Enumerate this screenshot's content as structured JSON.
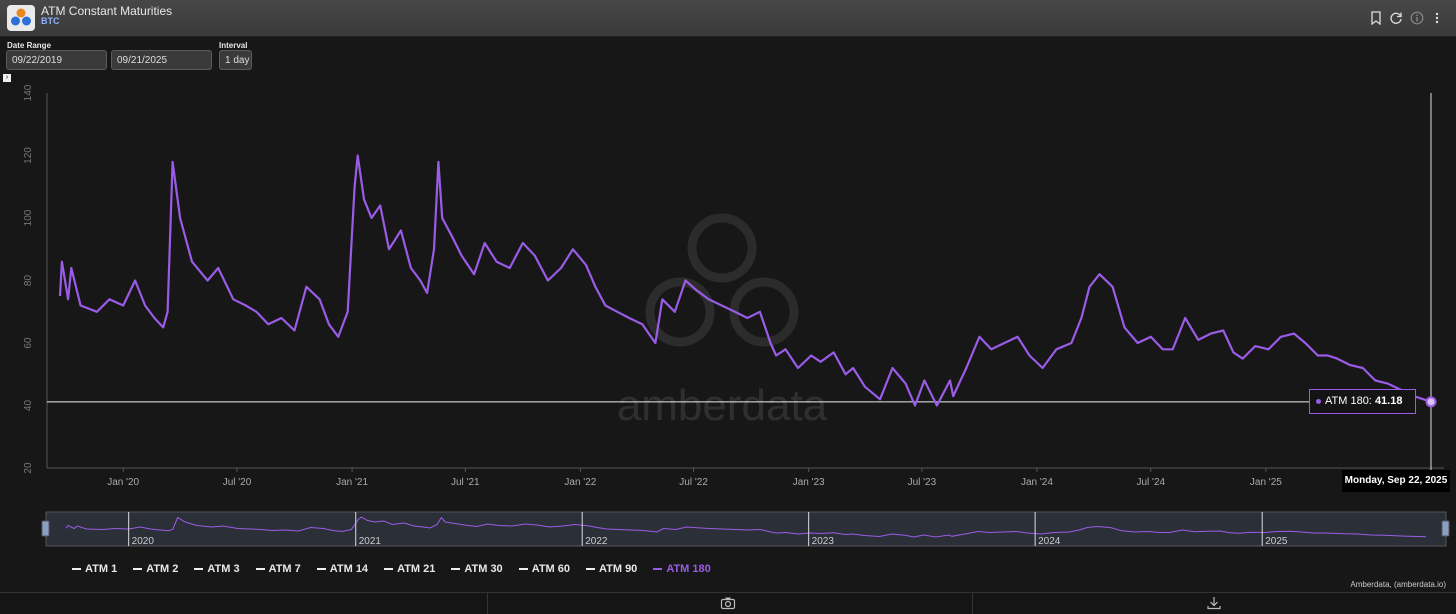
{
  "header": {
    "title": "ATM Constant Maturities",
    "subtitle": "BTC",
    "icons": [
      "bookmark-icon",
      "refresh-icon",
      "info-icon",
      "more-icon"
    ]
  },
  "controls": {
    "date_range_label": "Date Range",
    "start_date": "09/22/2019",
    "end_date": "09/21/2025",
    "interval_label": "Interval",
    "interval_value": "1 day"
  },
  "tooltip": {
    "series": "ATM 180: ",
    "value": "41.18",
    "date": "Monday, Sep 22, 2025"
  },
  "legend": [
    {
      "label": "ATM 1",
      "color": "#eeeeee",
      "active": false
    },
    {
      "label": "ATM 2",
      "color": "#eeeeee",
      "active": false
    },
    {
      "label": "ATM 3",
      "color": "#eeeeee",
      "active": false
    },
    {
      "label": "ATM 7",
      "color": "#eeeeee",
      "active": false
    },
    {
      "label": "ATM 14",
      "color": "#eeeeee",
      "active": false
    },
    {
      "label": "ATM 21",
      "color": "#eeeeee",
      "active": false
    },
    {
      "label": "ATM 30",
      "color": "#eeeeee",
      "active": false
    },
    {
      "label": "ATM 60",
      "color": "#eeeeee",
      "active": false
    },
    {
      "label": "ATM 90",
      "color": "#eeeeee",
      "active": false
    },
    {
      "label": "ATM 180",
      "color": "#9a5ce6",
      "active": true
    }
  ],
  "watermark": "amberdata",
  "credit": "Amberdata, (amberdata.io)",
  "chart_data": {
    "type": "line",
    "ylim": [
      20,
      140
    ],
    "yticks": [
      "20",
      "40",
      "60",
      "80",
      "100",
      "120",
      "140"
    ],
    "x_tick_labels": [
      "Jan '20",
      "Jul '20",
      "Jan '21",
      "Jul '21",
      "Jan '22",
      "Jul '22",
      "Jan '23",
      "Jul '23",
      "Jan '24",
      "Jul '24",
      "Jan '25"
    ],
    "navigator_labels": [
      "2020",
      "2021",
      "2022",
      "2023",
      "2024",
      "2025"
    ],
    "xlim": [
      "2019-09-22",
      "2025-09-22"
    ],
    "series": [
      {
        "name": "ATM 180",
        "color": "#9a5ce6",
        "x": [
          "2019-09-22",
          "2019-09-25",
          "2019-10-05",
          "2019-10-10",
          "2019-10-25",
          "2019-11-20",
          "2019-12-10",
          "2020-01-01",
          "2020-01-20",
          "2020-02-05",
          "2020-02-20",
          "2020-03-05",
          "2020-03-12",
          "2020-03-20",
          "2020-04-01",
          "2020-04-20",
          "2020-05-15",
          "2020-06-01",
          "2020-06-25",
          "2020-07-15",
          "2020-08-01",
          "2020-08-20",
          "2020-09-10",
          "2020-10-01",
          "2020-10-20",
          "2020-11-10",
          "2020-11-25",
          "2020-12-10",
          "2020-12-25",
          "2021-01-05",
          "2021-01-10",
          "2021-01-20",
          "2021-02-01",
          "2021-02-15",
          "2021-03-01",
          "2021-03-20",
          "2021-04-05",
          "2021-04-20",
          "2021-05-01",
          "2021-05-12",
          "2021-05-19",
          "2021-05-25",
          "2021-06-10",
          "2021-06-25",
          "2021-07-15",
          "2021-08-01",
          "2021-08-20",
          "2021-09-10",
          "2021-10-01",
          "2021-10-20",
          "2021-11-10",
          "2021-12-01",
          "2021-12-20",
          "2022-01-10",
          "2022-01-25",
          "2022-02-10",
          "2022-03-01",
          "2022-03-20",
          "2022-04-10",
          "2022-05-01",
          "2022-05-12",
          "2022-06-01",
          "2022-06-18",
          "2022-07-05",
          "2022-07-25",
          "2022-08-15",
          "2022-09-05",
          "2022-09-25",
          "2022-10-15",
          "2022-11-01",
          "2022-11-10",
          "2022-11-25",
          "2022-12-15",
          "2023-01-05",
          "2023-01-20",
          "2023-02-10",
          "2023-03-01",
          "2023-03-13",
          "2023-04-01",
          "2023-04-25",
          "2023-05-15",
          "2023-06-05",
          "2023-06-20",
          "2023-07-05",
          "2023-07-25",
          "2023-08-15",
          "2023-08-20",
          "2023-09-10",
          "2023-10-01",
          "2023-10-20",
          "2023-11-10",
          "2023-12-01",
          "2023-12-20",
          "2024-01-10",
          "2024-02-01",
          "2024-02-25",
          "2024-03-12",
          "2024-03-25",
          "2024-04-10",
          "2024-05-01",
          "2024-05-20",
          "2024-06-10",
          "2024-07-01",
          "2024-07-20",
          "2024-08-05",
          "2024-08-25",
          "2024-09-15",
          "2024-10-05",
          "2024-10-25",
          "2024-11-10",
          "2024-11-25",
          "2024-12-15",
          "2025-01-05",
          "2025-01-25",
          "2025-02-15",
          "2025-03-05",
          "2025-03-25",
          "2025-04-10",
          "2025-04-25",
          "2025-05-15",
          "2025-06-05",
          "2025-06-25",
          "2025-07-15",
          "2025-08-05",
          "2025-08-25",
          "2025-09-10",
          "2025-09-22"
        ],
        "y": [
          75,
          86,
          74,
          84,
          72,
          70,
          74,
          72,
          80,
          72,
          68,
          65,
          70,
          118,
          100,
          86,
          80,
          84,
          74,
          72,
          70,
          66,
          68,
          64,
          78,
          74,
          66,
          62,
          70,
          110,
          120,
          106,
          100,
          104,
          90,
          96,
          84,
          80,
          76,
          90,
          118,
          100,
          94,
          88,
          82,
          92,
          86,
          84,
          92,
          88,
          80,
          84,
          90,
          85,
          78,
          72,
          70,
          68,
          66,
          60,
          74,
          70,
          80,
          77,
          74,
          72,
          70,
          68,
          70,
          60,
          56,
          58,
          52,
          56,
          54,
          57,
          50,
          52,
          46,
          42,
          52,
          47,
          40,
          48,
          40,
          48,
          43,
          52,
          62,
          58,
          60,
          62,
          56,
          52,
          58,
          60,
          68,
          78,
          82,
          78,
          65,
          60,
          62,
          58,
          58,
          68,
          61,
          63,
          64,
          57,
          55,
          59,
          58,
          62,
          63,
          60,
          56,
          56,
          55,
          53,
          52,
          48,
          47,
          45,
          43,
          42,
          41.18
        ]
      }
    ]
  }
}
